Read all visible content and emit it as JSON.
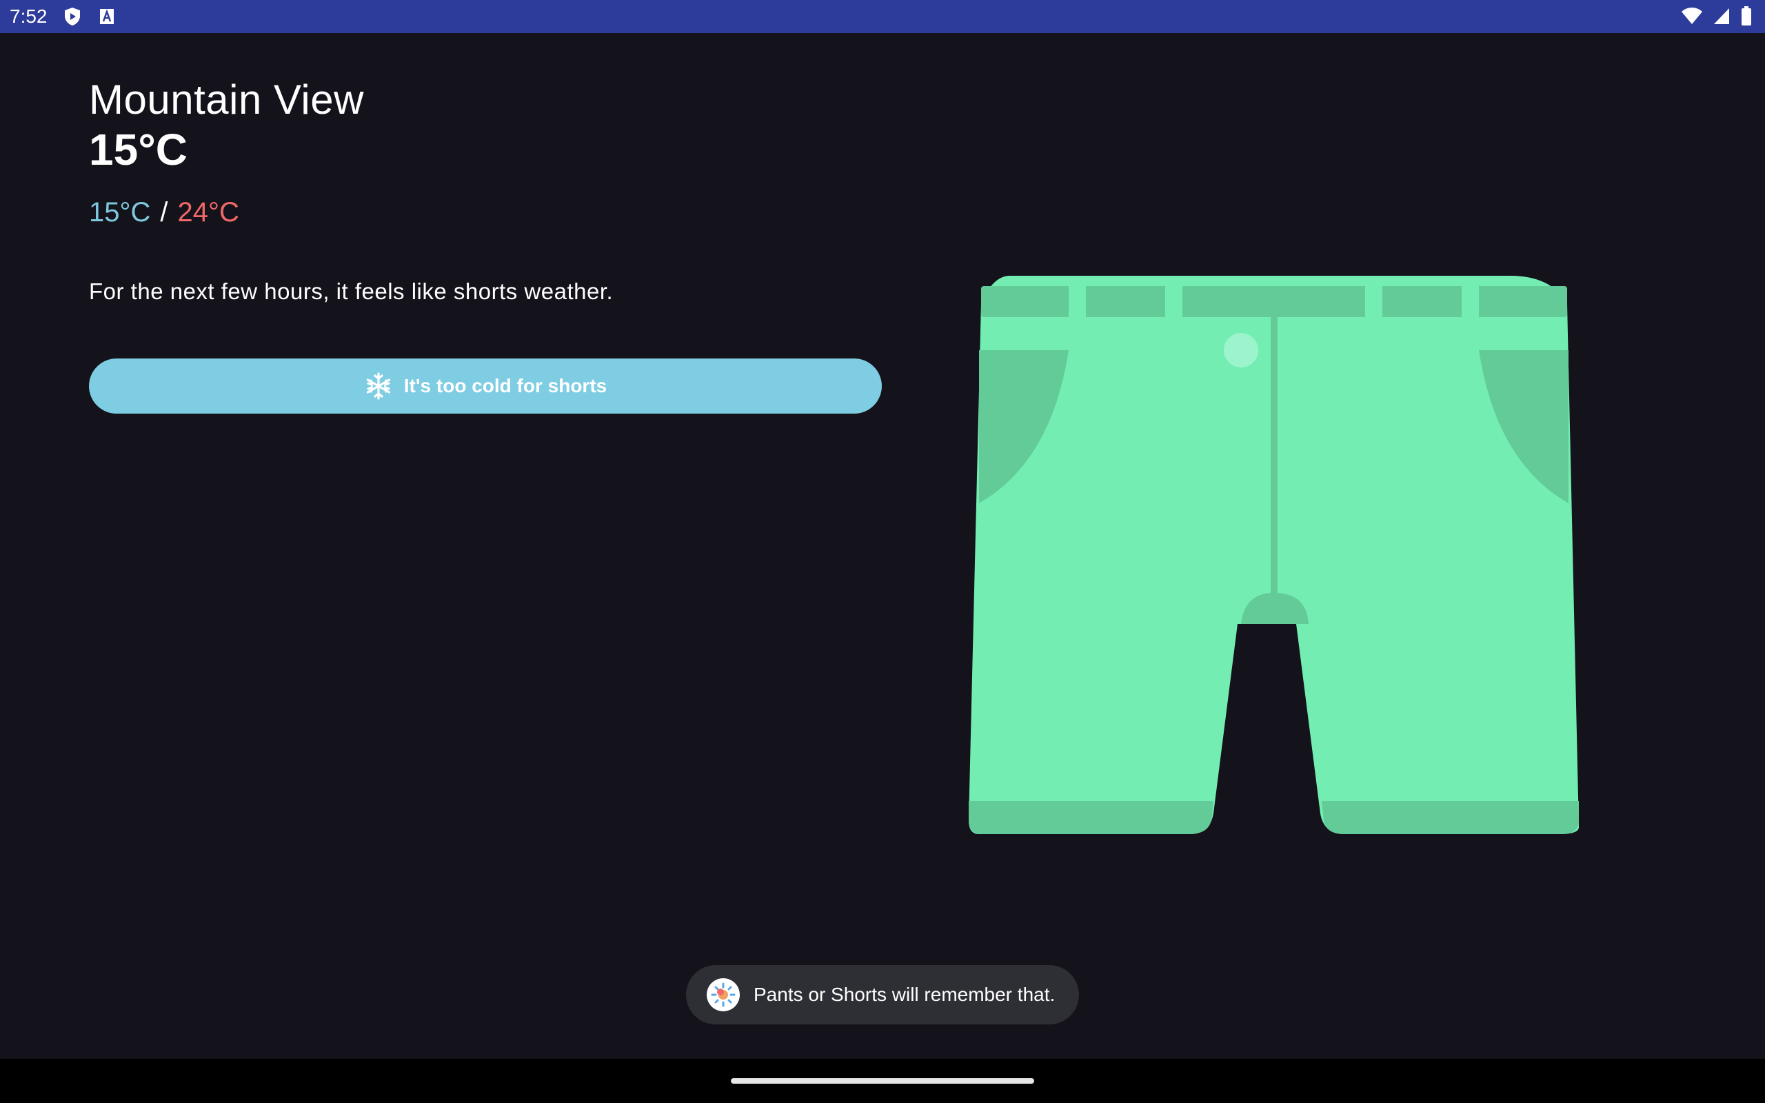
{
  "status_bar": {
    "time": "7:52",
    "left_icons": [
      "shield-play-icon",
      "a-box-icon"
    ],
    "right_icons": [
      "wifi-icon",
      "cellular-signal-icon",
      "battery-icon"
    ],
    "color": "#2d3b9a"
  },
  "weather": {
    "city": "Mountain View",
    "current_temp": "15°C",
    "low_temp": "15°C",
    "separator": "/",
    "high_temp": "24°C",
    "forecast": "For the next few hours, it feels like shorts weather."
  },
  "action_button": {
    "label": "It's too cold for shorts",
    "icon": "snowflake-icon",
    "color": "#7ecde2"
  },
  "illustration": {
    "icon": "shorts-illustration",
    "color": "#74edb2"
  },
  "toast": {
    "icon": "app-icon",
    "message": "Pants or Shorts will remember that."
  },
  "colors": {
    "background": "#14121a",
    "low_temp": "#7ec8de",
    "high_temp": "#f0686a"
  }
}
